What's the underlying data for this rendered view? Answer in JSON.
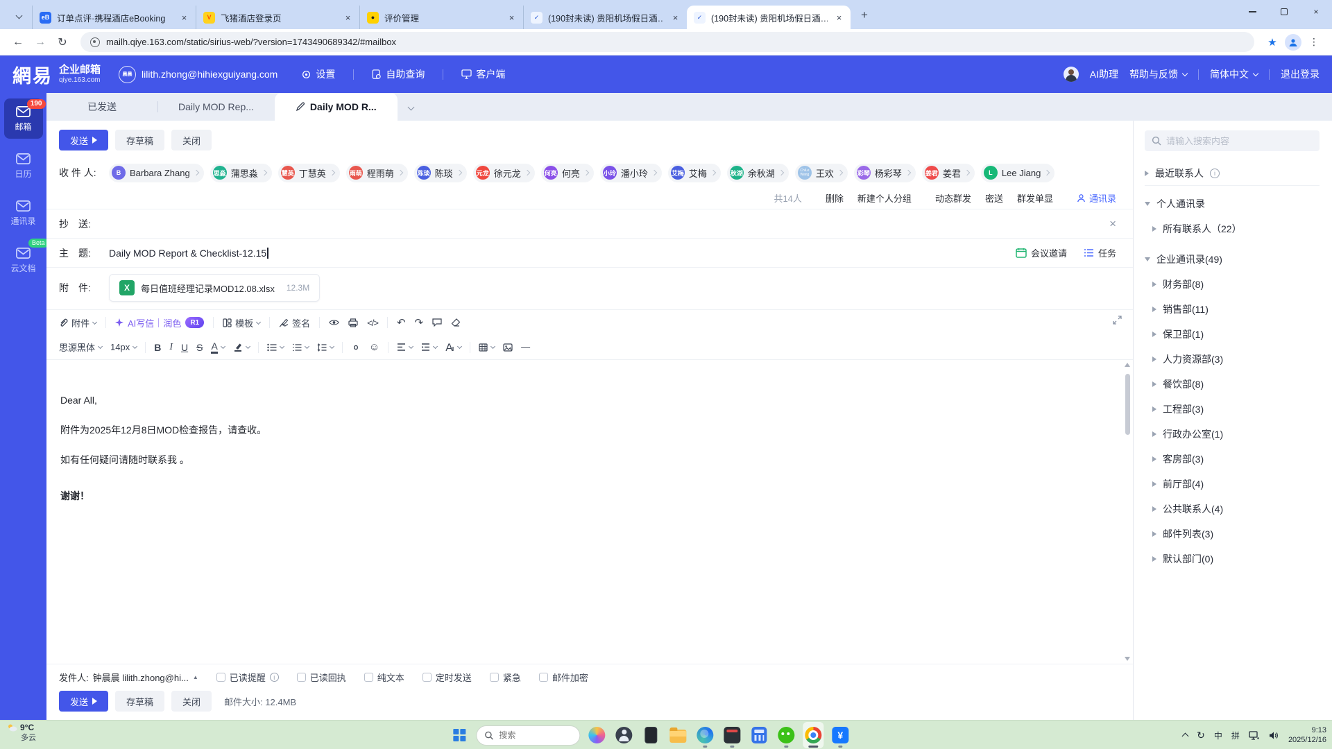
{
  "colors": {
    "brand_blue": "#4356e9",
    "link_blue": "#4c6aff",
    "badge_red": "#f5483d",
    "beta_green": "#2fd181",
    "excel_green": "#21a566",
    "ai_purple": "#7b5cf0"
  },
  "icons": {
    "back": "←",
    "forward": "→",
    "reload": "↻",
    "star": "★",
    "menu_dots": "⋮",
    "undo": "↶",
    "redo": "↷",
    "code": "</>",
    "hr": "—",
    "smiley": "☺",
    "caret_up": "▲",
    "yen": "¥",
    "xls": "X",
    "minimize": "—"
  },
  "browser": {
    "tabs": [
      {
        "title": "订单点评·携程酒店eBooking",
        "bg": "#2a6cf4",
        "fg": "#ffffff",
        "glyph": "eB",
        "cls": ""
      },
      {
        "title": "飞猪酒店登录页",
        "bg": "#ffd21e",
        "fg": "#ff5000",
        "glyph": "V",
        "cls": ""
      },
      {
        "title": "评价管理",
        "bg": "#ffd100",
        "fg": "#27241d",
        "glyph": "●",
        "cls": ""
      },
      {
        "title": "(190封未读) 贵阳机场假日酒…",
        "bg": "#eef4ff",
        "fg": "#2b5bd7",
        "glyph": "✓",
        "cls": ""
      },
      {
        "title": "(190封未读) 贵阳机场假日酒…",
        "bg": "#eef4ff",
        "fg": "#2b5bd7",
        "glyph": "✓",
        "cls": "active"
      }
    ],
    "url": "mailh.qiye.163.com/static/sirius-web/?version=1743490689342/#mailbox"
  },
  "header": {
    "brand_cn": "網易",
    "product": "企业邮箱",
    "domain": "qiye.163.com",
    "account": "lilith.zhong@hihiexguiyang.com",
    "account_abbr": "晨晨",
    "settings": "设置",
    "self_service": "自助查询",
    "client": "客户端",
    "ai_assistant": "AI助理",
    "help": "帮助与反馈",
    "language": "简体中文",
    "logout": "退出登录"
  },
  "rail": {
    "items": [
      {
        "label": "邮箱",
        "badge": "190",
        "cls": "active",
        "icon": "mail"
      },
      {
        "label": "日历",
        "icon": "calendar"
      },
      {
        "label": "通讯录",
        "icon": "person"
      },
      {
        "label": "云文档",
        "beta": "Beta",
        "icon": "cloud"
      }
    ]
  },
  "mail_tabs": {
    "items": [
      {
        "label": "已发送",
        "cls": ""
      },
      {
        "label": "Daily MOD Rep...",
        "cls": ""
      },
      {
        "label": "Daily MOD R...",
        "cls": "active",
        "pencil": true
      }
    ]
  },
  "compose": {
    "send": "发送",
    "save_draft": "存草稿",
    "close": "关闭",
    "to_label": "收 件 人:",
    "cc_label": "抄　送:",
    "subject_label": "主　题:",
    "attach_label": "附　件:",
    "recipients": [
      {
        "name": "Barbara Zhang",
        "abbr": "B",
        "color": "#6f6be8"
      },
      {
        "name": "蒲思淼",
        "abbr": "思淼",
        "color": "#21b390"
      },
      {
        "name": "丁慧英",
        "abbr": "慧英",
        "color": "#e8574e"
      },
      {
        "name": "程雨萌",
        "abbr": "雨萌",
        "color": "#e8574e"
      },
      {
        "name": "陈琰",
        "abbr": "陈琰",
        "color": "#4a5fe0"
      },
      {
        "name": "徐元龙",
        "abbr": "元龙",
        "color": "#f0483f"
      },
      {
        "name": "何亮",
        "abbr": "何亮",
        "color": "#8a4fe8"
      },
      {
        "name": "潘小玲",
        "abbr": "小玲",
        "color": "#7a52e8"
      },
      {
        "name": "艾梅",
        "abbr": "艾梅",
        "color": "#4a5fe0"
      },
      {
        "name": "余秋湖",
        "abbr": "秋湖",
        "color": "#1db389"
      },
      {
        "name": "王欢",
        "abbr": "ChiLe Wang",
        "color": "#9ec3e8",
        "cls": "tiny"
      },
      {
        "name": "杨彩琴",
        "abbr": "彩琴",
        "color": "#9a6ae8"
      },
      {
        "name": "姜君",
        "abbr": "姜君",
        "color": "#ef4b4b"
      },
      {
        "name": "Lee Jiang",
        "abbr": "L",
        "color": "#17b877"
      }
    ],
    "count": "共14人",
    "actions_group1": [
      "删除",
      "新建个人分组"
    ],
    "actions_group2": [
      "动态群发",
      "密送",
      "群发单显"
    ],
    "addressbook": "通讯录",
    "subject": "Daily MOD Report & Checklist-12.15",
    "meeting": "会议邀请",
    "task": "任务",
    "attachment": {
      "name": "每日值班经理记录MOD12.08.xlsx",
      "size": "12.3M"
    },
    "toolbar": {
      "attach": "附件",
      "ai_write": "AI写信",
      "polish": "润色",
      "ai_badge": "R1",
      "template": "模板",
      "sign": "签名"
    },
    "format": {
      "font": "思源黑体",
      "size": "14px",
      "bold": "B",
      "italic": "I",
      "underline": "U",
      "strike": "S",
      "color": "A"
    },
    "paragraphs": [
      "Dear All,",
      "附件为2025年12月8日MOD检查报告，请查收。",
      "如有任何疑问请随时联系我 。",
      "谢谢！"
    ],
    "footer": {
      "from_label": "发件人:",
      "from_value": "钟晨晨 lilith.zhong@hi...",
      "options": [
        {
          "label": "已读提醒",
          "info": true
        },
        {
          "label": "已读回执"
        },
        {
          "label": "纯文本"
        },
        {
          "label": "定时发送"
        },
        {
          "label": "紧急"
        },
        {
          "label": "邮件加密"
        }
      ],
      "size_note": "邮件大小: 12.4MB"
    }
  },
  "sidebar": {
    "search_placeholder": "请输入搜索内容",
    "rows": [
      {
        "arrow": "r",
        "label": "最近联系人",
        "info": true,
        "cls": "divided"
      },
      {
        "arrow": "d",
        "label": "个人通讯录",
        "cls": "sect"
      },
      {
        "arrow": "r",
        "label": "所有联系人（22）",
        "cls": "child"
      },
      {
        "arrow": "d",
        "label": "企业通讯录(49)",
        "cls": "sect"
      },
      {
        "arrow": "r",
        "label": "财务部(8)",
        "cls": "child"
      },
      {
        "arrow": "r",
        "label": "销售部(11)",
        "cls": "child"
      },
      {
        "arrow": "r",
        "label": "保卫部(1)",
        "cls": "child"
      },
      {
        "arrow": "r",
        "label": "人力资源部(3)",
        "cls": "child"
      },
      {
        "arrow": "r",
        "label": "餐饮部(8)",
        "cls": "child"
      },
      {
        "arrow": "r",
        "label": "工程部(3)",
        "cls": "child"
      },
      {
        "arrow": "r",
        "label": "行政办公室(1)",
        "cls": "child"
      },
      {
        "arrow": "r",
        "label": "客房部(3)",
        "cls": "child"
      },
      {
        "arrow": "r",
        "label": "前厅部(4)",
        "cls": "child"
      },
      {
        "arrow": "r",
        "label": "公共联系人(4)",
        "cls": "child"
      },
      {
        "arrow": "r",
        "label": "邮件列表(3)",
        "cls": "child"
      },
      {
        "arrow": "r",
        "label": "默认部门(0)",
        "cls": "child"
      }
    ]
  },
  "taskbar": {
    "search_placeholder": "搜索",
    "weather_temp": "9°C",
    "weather_desc": "多云",
    "ime_lang": "中",
    "ime_mode": "拼",
    "time": "9:13",
    "date": "2025/12/16"
  }
}
